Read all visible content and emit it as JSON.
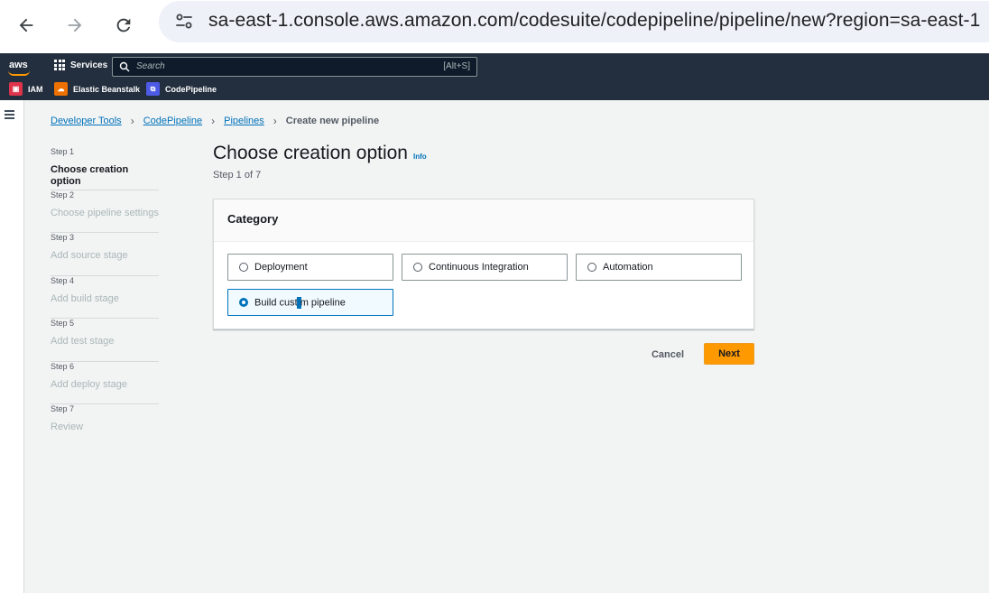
{
  "browser": {
    "url": "sa-east-1.console.aws.amazon.com/codesuite/codepipeline/pipeline/new?region=sa-east-1"
  },
  "aws_nav": {
    "logo": "aws",
    "services_label": "Services",
    "search_placeholder": "Search",
    "search_shortcut": "[Alt+S]",
    "favorites": [
      {
        "label": "IAM",
        "icon": "iam-icon",
        "color": "#dd344c"
      },
      {
        "label": "Elastic Beanstalk",
        "icon": "elastic-beanstalk-icon",
        "color": "#ed7100"
      },
      {
        "label": "CodePipeline",
        "icon": "codepipeline-icon",
        "color": "#4d5ae6"
      }
    ]
  },
  "breadcrumb": {
    "items": [
      "Developer Tools",
      "CodePipeline",
      "Pipelines"
    ],
    "current": "Create new pipeline"
  },
  "steps": [
    {
      "num": "Step 1",
      "title": "Choose creation option",
      "active": true
    },
    {
      "num": "Step 2",
      "title": "Choose pipeline settings",
      "active": false
    },
    {
      "num": "Step 3",
      "title": "Add source stage",
      "active": false
    },
    {
      "num": "Step 4",
      "title": "Add build stage",
      "active": false
    },
    {
      "num": "Step 5",
      "title": "Add test stage",
      "active": false
    },
    {
      "num": "Step 6",
      "title": "Add deploy stage",
      "active": false
    },
    {
      "num": "Step 7",
      "title": "Review",
      "active": false
    }
  ],
  "page": {
    "title": "Choose creation option",
    "info": "Info",
    "step_of": "Step 1 of 7"
  },
  "category": {
    "header": "Category",
    "options": [
      {
        "label": "Deployment",
        "selected": false
      },
      {
        "label": "Continuous Integration",
        "selected": false
      },
      {
        "label": "Automation",
        "selected": false
      },
      {
        "label_before_caret": "Build cust",
        "label_after_caret": "m pipeline",
        "label": "Build custom pipeline",
        "selected": true
      }
    ]
  },
  "actions": {
    "cancel": "Cancel",
    "next": "Next"
  },
  "colors": {
    "aws_nav_bg": "#232f3e",
    "link": "#0073bb",
    "primary_button": "#ff9900"
  }
}
